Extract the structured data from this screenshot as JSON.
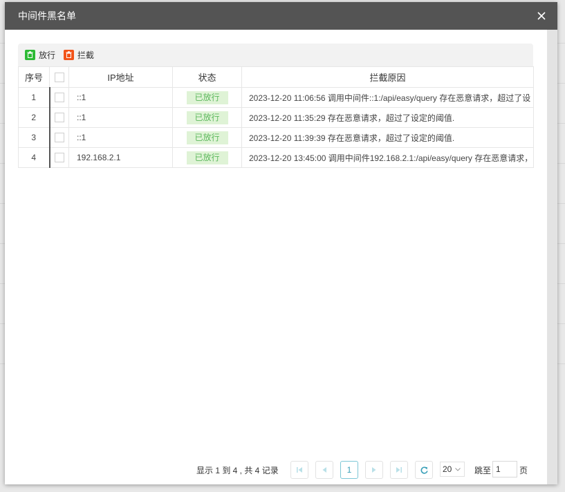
{
  "dialog": {
    "title": "中间件黑名单"
  },
  "toolbar": {
    "release_label": "放行",
    "block_label": "拦截"
  },
  "table": {
    "headers": {
      "seq": "序号",
      "ip": "IP地址",
      "state": "状态",
      "reason": "拦截原因"
    },
    "rows": [
      {
        "seq": "1",
        "ip": "::1",
        "state": "已放行",
        "reason": "2023-12-20 11:06:56 调用中间件::1:/api/easy/query 存在恶意请求，超过了设"
      },
      {
        "seq": "2",
        "ip": "::1",
        "state": "已放行",
        "reason": "2023-12-20 11:35:29 存在恶意请求，超过了设定的阈值."
      },
      {
        "seq": "3",
        "ip": "::1",
        "state": "已放行",
        "reason": "2023-12-20 11:39:39 存在恶意请求，超过了设定的阈值."
      },
      {
        "seq": "4",
        "ip": "192.168.2.1",
        "state": "已放行",
        "reason": "2023-12-20 13:45:00 调用中间件192.168.2.1:/api/easy/query 存在恶意请求，"
      }
    ]
  },
  "pager": {
    "info": "显示 1 到 4 , 共 4 记录",
    "current_page": "1",
    "page_size": "20",
    "jump_label": "跳至",
    "jump_value": "1",
    "jump_suffix": "页"
  },
  "colors": {
    "header_bg": "#545454",
    "release_icon": "#2dba35",
    "block_icon": "#f2541a",
    "badge_bg": "#dff3d6",
    "badge_text": "#5cb85c",
    "pager_accent": "#3aa0b8"
  },
  "icons": {
    "close": "close-icon",
    "release": "trash-icon",
    "block": "trash-icon",
    "first": "first-page-icon",
    "prev": "prev-page-icon",
    "next": "next-page-icon",
    "last": "last-page-icon",
    "refresh": "refresh-icon",
    "dropdown": "chevron-down-icon"
  }
}
